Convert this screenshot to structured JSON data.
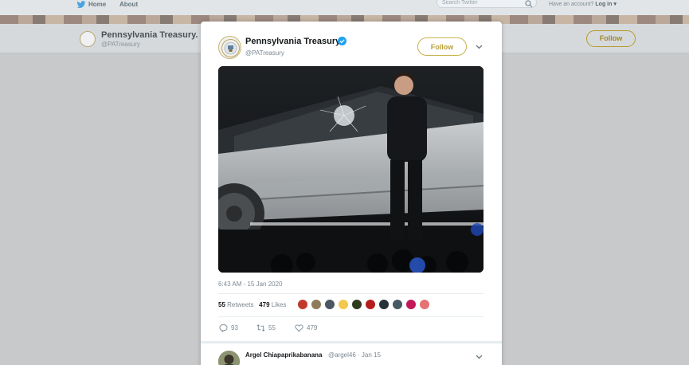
{
  "topnav": {
    "home_label": "Home",
    "about_label": "About",
    "search_placeholder": "Search Twitter",
    "account_prompt": "Have an account?",
    "login_label": "Log in",
    "login_caret": "▾"
  },
  "profile_bar": {
    "name": "Pennsylvania Treasury.",
    "handle": "@PATreasury",
    "follow_label": "Follow"
  },
  "tweet": {
    "author_name": "Pennsylvania Treasury.",
    "author_handle": "@PATreasury",
    "follow_label": "Follow",
    "timestamp": "6:43 AM - 15 Jan 2020",
    "retweets_count": "55",
    "retweets_label": "Retweets",
    "likes_count": "479",
    "likes_label": "Likes",
    "reply_count": "93",
    "retweet_action_count": "55",
    "like_action_count": "479",
    "liker_colors": [
      "#c0392b",
      "#8e7d5a",
      "#4b5663",
      "#f2c94c",
      "#2d3a1e",
      "#b71c1c",
      "#263238",
      "#455a64",
      "#c2185b",
      "#e57373"
    ]
  },
  "reply": {
    "name": "Argel Chiapaprikabanana",
    "handle_time": "@argel46 · Jan 15"
  },
  "colors": {
    "verified": "#1da1f2",
    "follow_gold": "#c9b34e",
    "overlay": "#c7c9cb"
  }
}
